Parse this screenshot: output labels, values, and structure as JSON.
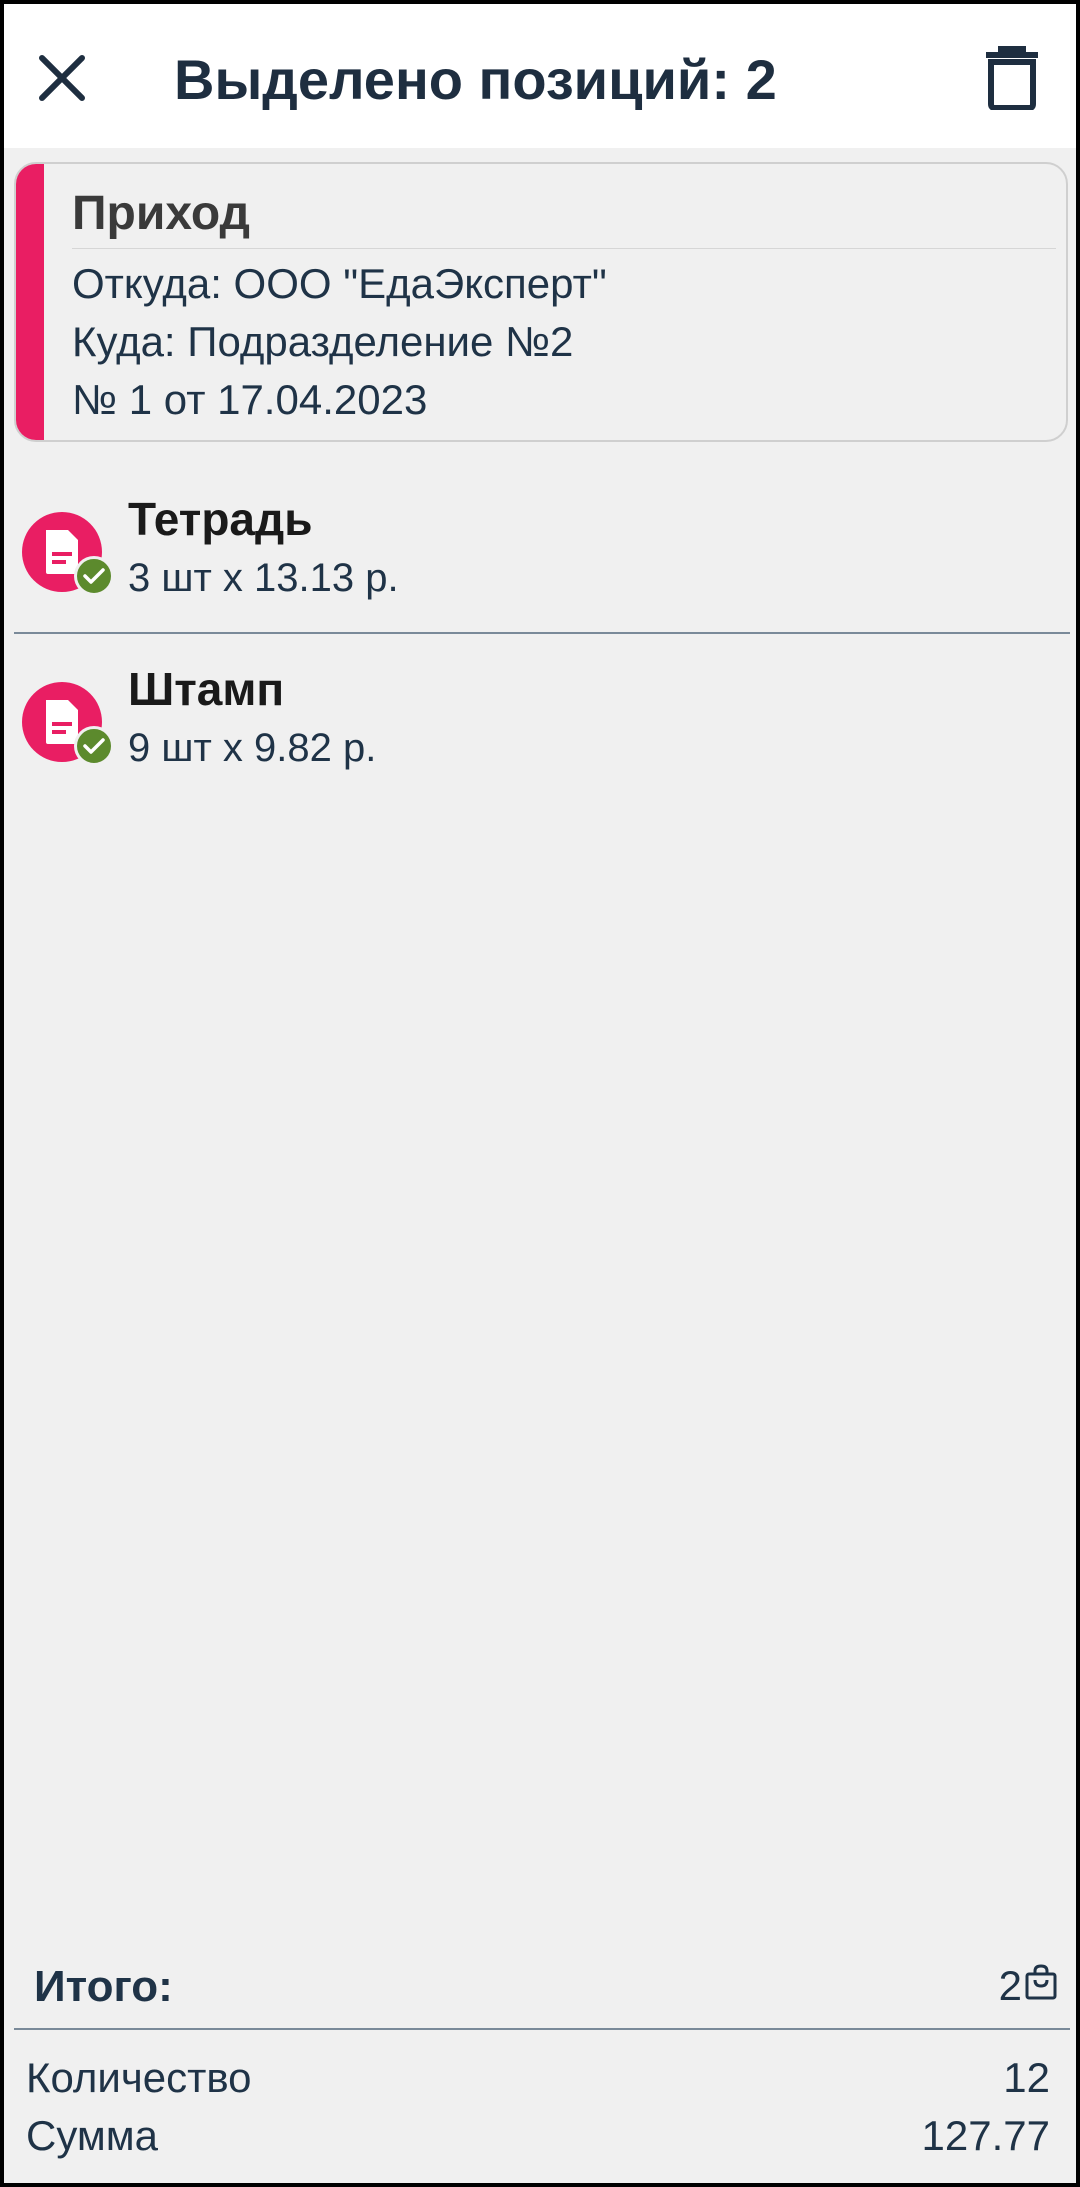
{
  "appbar": {
    "title": "Выделено позиций: 2",
    "close_icon": "close-icon",
    "delete_icon": "trash-icon"
  },
  "document": {
    "type": "Приход",
    "from": "Откуда: ООО \"ЕдаЭксперт\"",
    "to": "Куда: Подразделение №2",
    "number": "№ 1 от 17.04.2023",
    "accent_color": "#e91e63"
  },
  "items": [
    {
      "name": "Тетрадь",
      "qty": "3 шт х 13.13 р.",
      "icon": "document-icon",
      "status_icon": "check-icon"
    },
    {
      "name": "Штамп",
      "qty": "9 шт х 9.82 р.",
      "icon": "document-icon",
      "status_icon": "check-icon"
    }
  ],
  "totals": {
    "title": "Итого:",
    "count": "2",
    "count_icon": "bag-icon",
    "quantity_label": "Количество",
    "quantity_value": "12",
    "sum_label": "Сумма",
    "sum_value": "127.77"
  }
}
